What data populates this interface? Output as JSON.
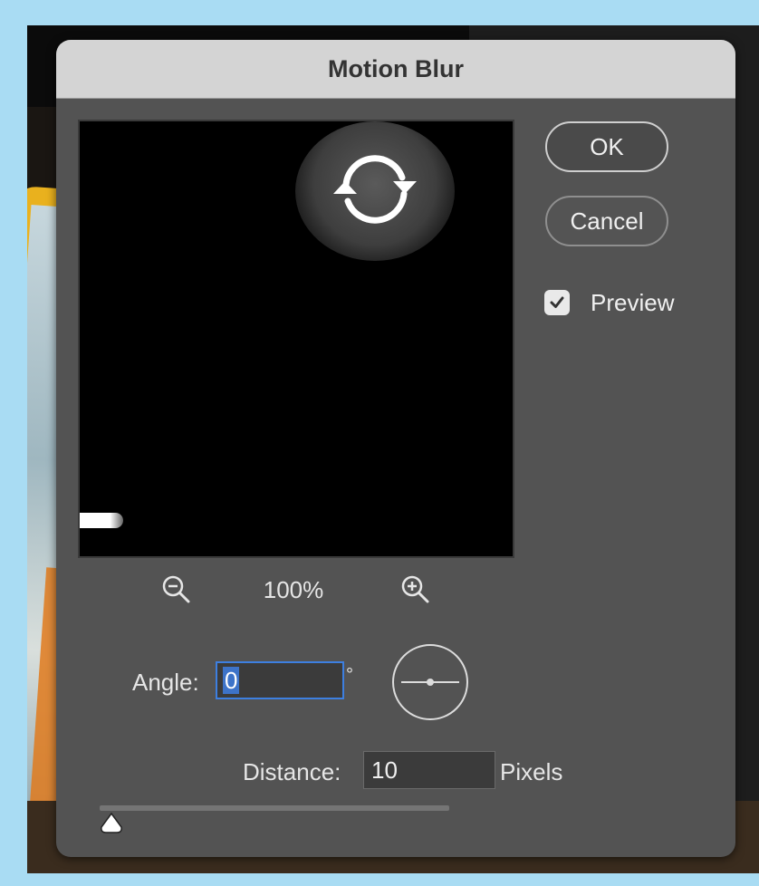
{
  "dialog": {
    "title": "Motion Blur"
  },
  "buttons": {
    "ok": "OK",
    "cancel": "Cancel"
  },
  "preview": {
    "label": "Preview",
    "checked": true
  },
  "zoom": {
    "level": "100%"
  },
  "angle": {
    "label": "Angle:",
    "value": "0",
    "unit": "°"
  },
  "distance": {
    "label": "Distance:",
    "value": "10",
    "unit": "Pixels",
    "slider_value": 10
  },
  "icons": {
    "zoom_out": "zoom-out-icon",
    "zoom_in": "zoom-in-icon",
    "loading": "refresh-spinner-icon",
    "check": "checkmark-icon",
    "angle_dial": "angle-dial-icon"
  },
  "colors": {
    "dialog_bg": "#535353",
    "titlebar_bg": "#d4d4d4",
    "focus_ring": "#3d7fe0",
    "selection": "#3d73c8"
  }
}
